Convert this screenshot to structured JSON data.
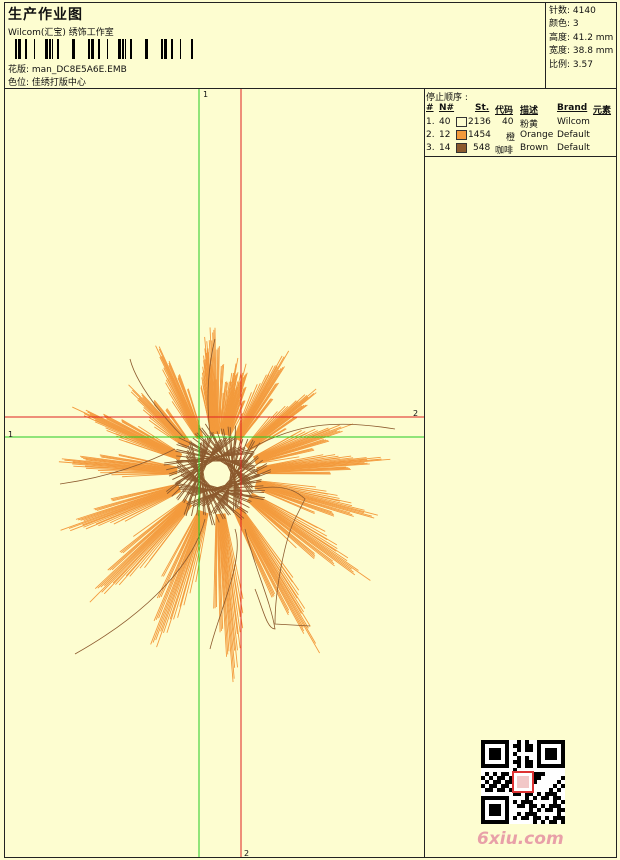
{
  "header": {
    "title": "生产作业图",
    "studio": "Wilcom(汇宝) 绣饰工作室",
    "design_label": "花版: man_DC8E5A6E.EMB",
    "color_position": "色位: 佳绣打版中心"
  },
  "stats": {
    "stitches": "针数: 4140",
    "colors": "颜色: 3",
    "height": "高度: 41.2 mm",
    "width": "宽度: 38.8 mm",
    "ratio": "比例: 3.57"
  },
  "stop_sequence": {
    "title": "停止顺序 :",
    "columns": [
      "#",
      "N#",
      "St.",
      "代码",
      "描述",
      "Brand",
      "元素"
    ],
    "rows": [
      {
        "idx": "1.",
        "n": "40",
        "stitches": "2136",
        "code": "40",
        "desc": "粉黄",
        "brand": "Wilcom",
        "color": "#fdfdd0"
      },
      {
        "idx": "2.",
        "n": "12",
        "stitches": "1454",
        "code": "橙",
        "desc": "Orange",
        "brand": "Default",
        "color": "#f39a3c"
      },
      {
        "idx": "3.",
        "n": "14",
        "stitches": "548",
        "code": "咖啡",
        "desc": "Brown",
        "brand": "Default",
        "color": "#8c5a2e"
      }
    ]
  },
  "axes": {
    "green_label_top": "1",
    "green_label_left": "1",
    "red_label_right": "2",
    "red_label_bottom": "2"
  },
  "watermark": {
    "text": "6xiu.com"
  },
  "colors": {
    "paper": "#fdfdd0",
    "petal": "#f39a3c",
    "center": "#8c5a2e",
    "green_axis": "#22cc22",
    "red_axis": "#e02020"
  }
}
